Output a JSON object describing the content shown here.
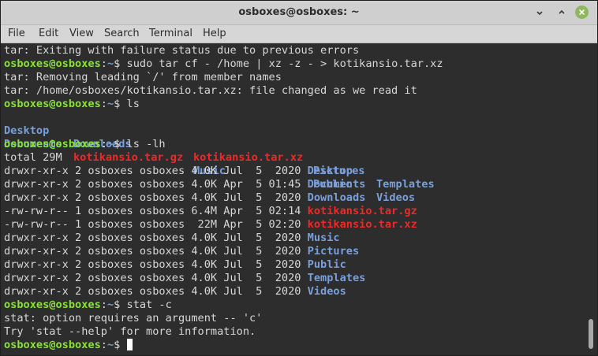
{
  "window": {
    "title": "osboxes@osboxes: ~",
    "accent": "#8fb85c"
  },
  "menu": [
    "File",
    "Edit",
    "View",
    "Search",
    "Terminal",
    "Help"
  ],
  "terminal": {
    "lines": [
      "tar: Exiting with failure status due to previous errors",
      "tar: Removing leading `/' from member names",
      "tar: /home/osboxes/kotikansio.tar.xz: file changed as we read it",
      "total 29M",
      "stat: option requires an argument -- 'c'",
      "Try 'stat --help' for more information."
    ],
    "prompt_user": "osboxes@osboxes",
    "prompt_sep": ":",
    "prompt_path": "~",
    "prompt_dollar": "$",
    "commands": [
      "sudo tar cf - /home | xz -z - > kotikansio.tar.xz",
      "ls",
      "ls -lh",
      "stat -c"
    ],
    "ls": [
      [
        "Desktop",
        "Downloads",
        "kotikansio.tar.xz",
        "Pictures",
        "Templates"
      ],
      [
        "Documents",
        "kotikansio.tar.gz",
        "Music",
        "Public",
        "Videos"
      ]
    ],
    "long_list": [
      {
        "meta": "drwxr-xr-x 2 osboxes osboxes 4.0K Jul  5  2020 ",
        "name": "Desktop",
        "kind": "dir"
      },
      {
        "meta": "drwxr-xr-x 2 osboxes osboxes 4.0K Apr  5 01:45 ",
        "name": "Documents",
        "kind": "dir"
      },
      {
        "meta": "drwxr-xr-x 2 osboxes osboxes 4.0K Jul  5  2020 ",
        "name": "Downloads",
        "kind": "dir"
      },
      {
        "meta": "-rw-rw-r-- 1 osboxes osboxes 6.4M Apr  5 02:14 ",
        "name": "kotikansio.tar.gz",
        "kind": "archive"
      },
      {
        "meta": "-rw-rw-r-- 1 osboxes osboxes  22M Apr  5 02:20 ",
        "name": "kotikansio.tar.xz",
        "kind": "archive"
      },
      {
        "meta": "drwxr-xr-x 2 osboxes osboxes 4.0K Jul  5  2020 ",
        "name": "Music",
        "kind": "dir"
      },
      {
        "meta": "drwxr-xr-x 2 osboxes osboxes 4.0K Jul  5  2020 ",
        "name": "Pictures",
        "kind": "dir"
      },
      {
        "meta": "drwxr-xr-x 2 osboxes osboxes 4.0K Jul  5  2020 ",
        "name": "Public",
        "kind": "dir"
      },
      {
        "meta": "drwxr-xr-x 2 osboxes osboxes 4.0K Jul  5  2020 ",
        "name": "Templates",
        "kind": "dir"
      },
      {
        "meta": "drwxr-xr-x 2 osboxes osboxes 4.0K Jul  5  2020 ",
        "name": "Videos",
        "kind": "dir"
      }
    ],
    "colors": {
      "prompt": "#8ae234",
      "path": "#729fcf",
      "directory": "#7b9fd8",
      "archive": "#ef2929"
    }
  }
}
